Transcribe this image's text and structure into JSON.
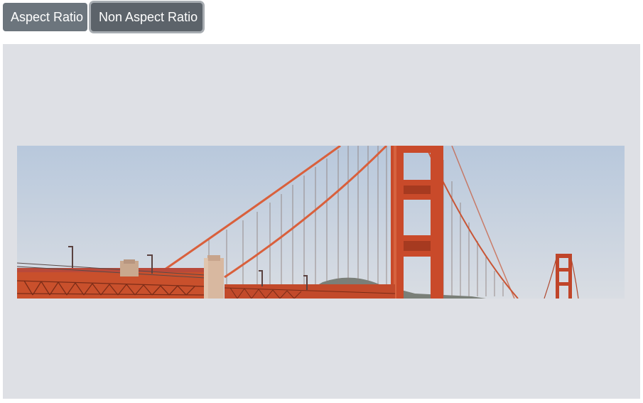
{
  "toolbar": {
    "aspect_label": "Aspect Ratio",
    "non_aspect_label": "Non Aspect Ratio",
    "button_color": "#6c757d",
    "active_button_color": "#5c636a"
  },
  "stage": {
    "background": "#dee0e5",
    "image_subject": "golden-gate-bridge",
    "mode": "non-aspect-ratio"
  }
}
